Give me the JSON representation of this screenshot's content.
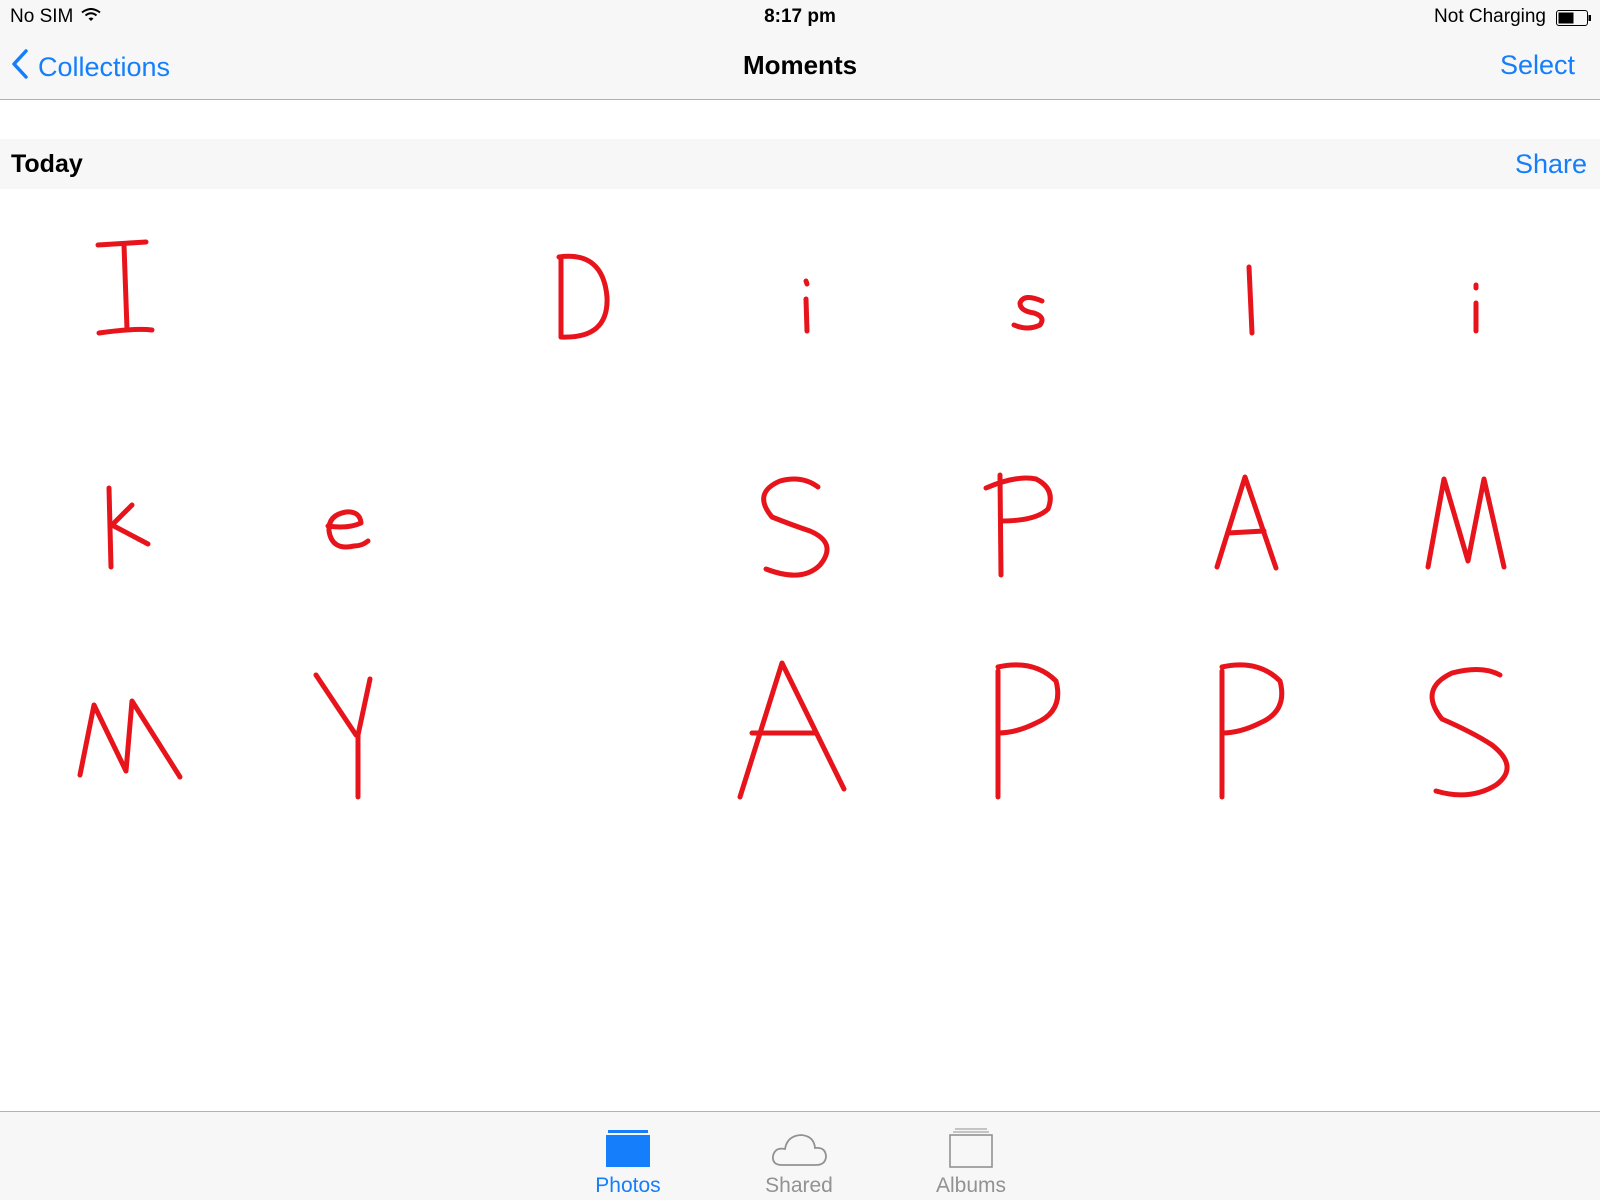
{
  "status_bar": {
    "carrier": "No SIM",
    "time": "8:17 pm",
    "charging": "Not Charging",
    "wifi_icon": "wifi-icon",
    "battery_icon": "battery-icon"
  },
  "nav": {
    "back_label": "Collections",
    "title": "Moments",
    "select_label": "Select"
  },
  "section": {
    "title": "Today",
    "share_label": "Share"
  },
  "photos": [
    {
      "glyph": "I"
    },
    {
      "glyph": ""
    },
    {
      "glyph": "D"
    },
    {
      "glyph": "i"
    },
    {
      "glyph": "s"
    },
    {
      "glyph": "l"
    },
    {
      "glyph": "i"
    },
    {
      "glyph": "k"
    },
    {
      "glyph": "e"
    },
    {
      "glyph": ""
    },
    {
      "glyph": "S"
    },
    {
      "glyph": "P"
    },
    {
      "glyph": "A"
    },
    {
      "glyph": "M"
    },
    {
      "glyph": "M"
    },
    {
      "glyph": "Y"
    },
    {
      "glyph": ""
    },
    {
      "glyph": "A"
    },
    {
      "glyph": "P"
    },
    {
      "glyph": "P"
    },
    {
      "glyph": "S"
    }
  ],
  "tabs": [
    {
      "label": "Photos",
      "icon": "photos-icon",
      "selected": true
    },
    {
      "label": "Shared",
      "icon": "cloud-icon",
      "selected": false
    },
    {
      "label": "Albums",
      "icon": "albums-icon",
      "selected": false
    }
  ],
  "colors": {
    "accent": "#147efb",
    "ink": "#e8141c",
    "bar_background": "#f7f7f7",
    "inactive_tab": "#929292"
  }
}
